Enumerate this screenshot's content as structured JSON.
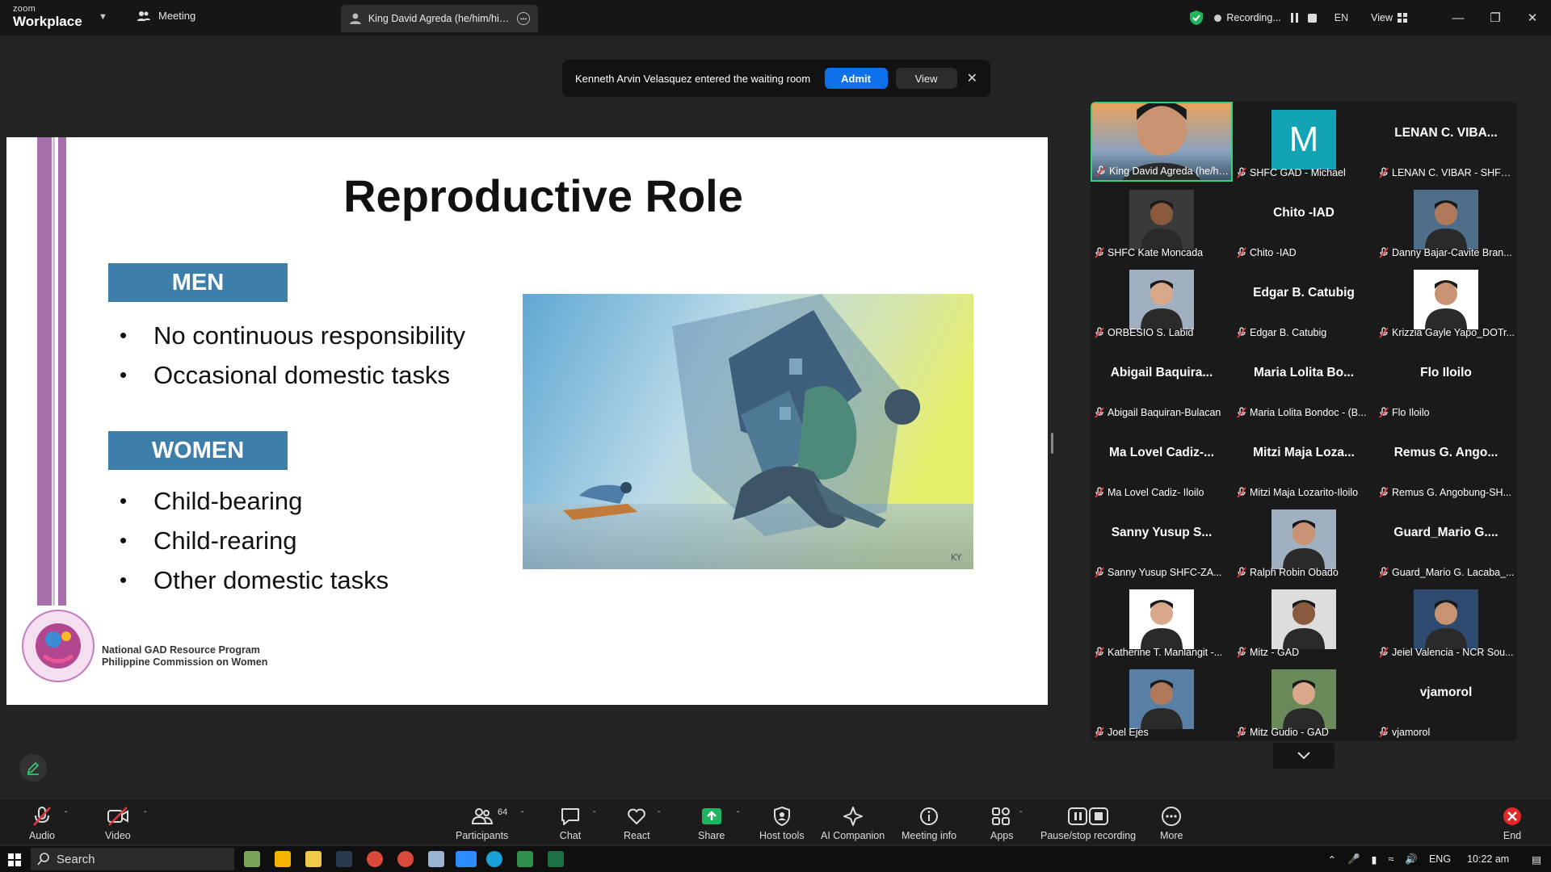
{
  "titlebar": {
    "brand_top": "zoom",
    "brand_bottom": "Workplace",
    "meeting_tab": "Meeting",
    "share_tab": "King David Agreda (he/him/his)'s",
    "recording": "Recording...",
    "language": "EN",
    "view": "View"
  },
  "notification": {
    "message": "Kenneth Arvin Velasquez entered the waiting room",
    "admit": "Admit",
    "view": "View"
  },
  "slide": {
    "title": "Reproductive Role",
    "men_label": "MEN",
    "men_items": [
      "No continuous responsibility",
      "Occasional domestic tasks"
    ],
    "women_label": "WOMEN",
    "women_items": [
      "Child-bearing",
      "Child-rearing",
      "Other domestic tasks"
    ],
    "org_line1": "National GAD Resource Program",
    "org_line2": "Philippine Commission on Women",
    "illustration_signature": "KY"
  },
  "gallery": [
    {
      "name": "King David Agreda (he/him...",
      "video": true,
      "active": true
    },
    {
      "name": "SHFC GAD - Michael",
      "avatar": "M",
      "avatar_color": "#12a4b4"
    },
    {
      "name": "LENAN C. VIBAR - SHFC ...",
      "big": "LENAN C. VIBA..."
    },
    {
      "name": "SHFC Kate Moncada",
      "video": true
    },
    {
      "name": "Chito -IAD",
      "big": "Chito -IAD"
    },
    {
      "name": "Danny Bajar-Cavite Bran...",
      "video": true
    },
    {
      "name": "ORBESIO  S. Labid",
      "video": true
    },
    {
      "name": "Edgar B. Catubig",
      "big": "Edgar B. Catubig"
    },
    {
      "name": "Krizzia Gayle Yapo_DOTr...",
      "video": true
    },
    {
      "name": "Abigail Baquiran-Bulacan",
      "big": "Abigail Baquira..."
    },
    {
      "name": "Maria Lolita Bondoc - (B...",
      "big": "Maria Lolita Bo..."
    },
    {
      "name": "Flo Iloilo",
      "big": "Flo Iloilo"
    },
    {
      "name": "Ma Lovel Cadiz- Iloilo",
      "big": "Ma Lovel Cadiz-..."
    },
    {
      "name": "Mitzi Maja Lozarito-Iloilo",
      "big": "Mitzi Maja Loza..."
    },
    {
      "name": "Remus G. Angobung-SH...",
      "big": "Remus G. Ango..."
    },
    {
      "name": "Sanny  Yusup SHFC-ZA...",
      "big": "Sanny  Yusup S..."
    },
    {
      "name": "Ralph Robin Obado",
      "video": true
    },
    {
      "name": "Guard_Mario G. Lacaba_...",
      "big": "Guard_Mario  G...."
    },
    {
      "name": "Katherine T. Manlangit -...",
      "video": true
    },
    {
      "name": "Mitz - GAD",
      "video": true
    },
    {
      "name": "Jeiel Valencia - NCR Sou...",
      "video": true
    },
    {
      "name": "Joel Ejes",
      "video": true
    },
    {
      "name": "Mitz Gudio - GAD",
      "video": true
    },
    {
      "name": "vjamorol",
      "big": "vjamorol"
    }
  ],
  "toolbar": {
    "audio": "Audio",
    "video": "Video",
    "participants": "Participants",
    "participants_count": "64",
    "chat": "Chat",
    "react": "React",
    "share": "Share",
    "host_tools": "Host tools",
    "ai_companion": "AI Companion",
    "meeting_info": "Meeting info",
    "apps": "Apps",
    "pause_stop": "Pause/stop recording",
    "more": "More",
    "end": "End"
  },
  "taskbar": {
    "search": "Search",
    "lang": "ENG",
    "time": "10:22 am"
  },
  "colors": {
    "accent": "#0e71eb",
    "active_speaker": "#34d17a",
    "slide_label": "#3e7eaa",
    "slide_bar": "#a86fad",
    "end": "#e02828"
  }
}
